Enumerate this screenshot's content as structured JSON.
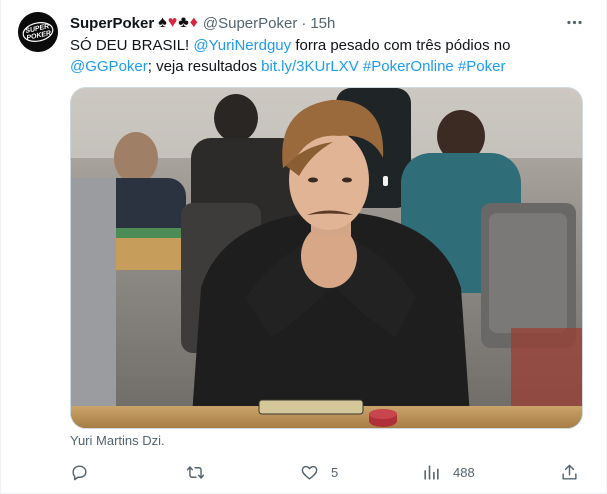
{
  "author": {
    "display_name": "SuperPoker",
    "suits": [
      "♠",
      "♥",
      "♣",
      "♦"
    ],
    "handle": "@SuperPoker",
    "separator": "·",
    "time": "15h",
    "avatar_text": "SUPER POKER"
  },
  "tweet": {
    "text_part1": "SÓ DEU BRASIL! ",
    "mention1": "@YuriNerdguy",
    "text_part2": " forra pesado com três pódios no ",
    "mention2": "@GGPoker",
    "text_part3": "; veja resultados ",
    "link": "bit.ly/3KUrLXV",
    "hashtag1": "#PokerOnline",
    "hashtag2": "#Poker"
  },
  "media": {
    "caption": "Yuri Martins Dzi."
  },
  "actions": {
    "reply_count": "",
    "retweet_count": "",
    "like_count": "5",
    "views_count": "488"
  },
  "colors": {
    "link": "#1d9bf0",
    "secondary_text": "#536471",
    "red_suit": "#d7263d"
  }
}
